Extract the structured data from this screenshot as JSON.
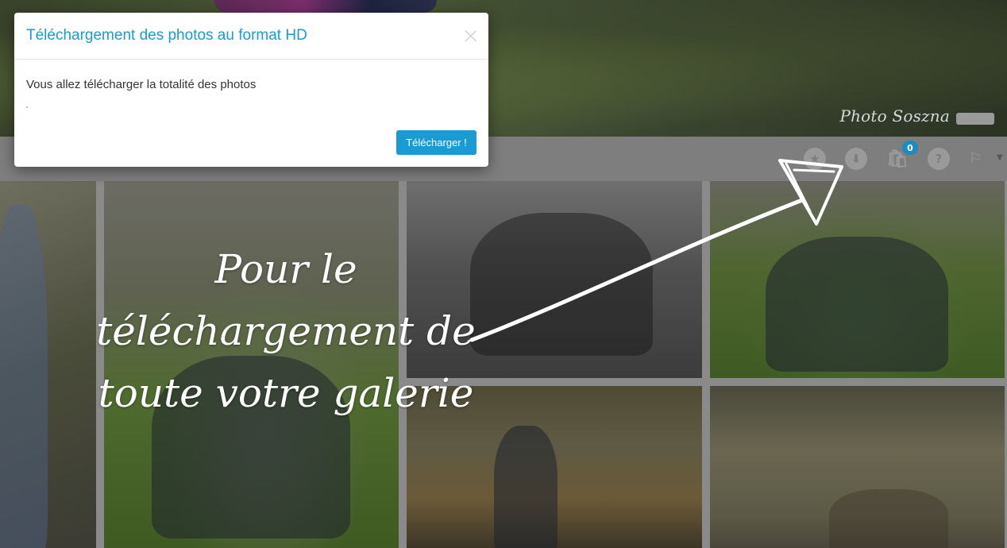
{
  "header": {
    "brand": "Photo Soszna"
  },
  "toolbar": {
    "icons": [
      "star-icon",
      "download-icon",
      "shopping-bag-icon",
      "help-icon",
      "flag-icon"
    ],
    "help_label": "?",
    "cart_count": "0"
  },
  "modal": {
    "title": "Téléchargement des photos au format HD",
    "close_label": "×",
    "message": "Vous allez télécharger la totalité des photos",
    "download_button": "Télécharger !"
  },
  "annotation": {
    "line1": "Pour le téléchargement de",
    "line2": "toute votre galerie"
  },
  "colors": {
    "accent": "#1a9bd4",
    "badge": "#1d8ac0"
  }
}
